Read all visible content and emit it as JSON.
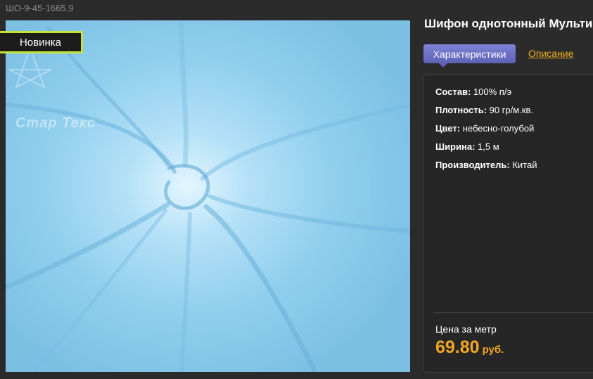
{
  "product": {
    "sku": "ШО-9-45-1665.9",
    "badge": "Новинка",
    "watermark": "Стар Текс",
    "title": "Шифон однотонный Мульти"
  },
  "tabs": {
    "characteristics": "Характеристики",
    "description": "Описание"
  },
  "specs": [
    {
      "label": "Состав:",
      "value": "100% п/э"
    },
    {
      "label": "Плотность:",
      "value": "90 гр/м.кв."
    },
    {
      "label": "Цвет:",
      "value": "небесно-голубой"
    },
    {
      "label": "Ширина:",
      "value": "1,5 м"
    },
    {
      "label": "Производитель:",
      "value": "Китай"
    }
  ],
  "price": {
    "label": "Цена за метр",
    "value": "69.80",
    "currency": "руб."
  },
  "colors": {
    "accent": "#f5a623",
    "tab_active": "#6a6fc4",
    "badge_border": "#c6e336",
    "fabric": "#8ccdec"
  }
}
